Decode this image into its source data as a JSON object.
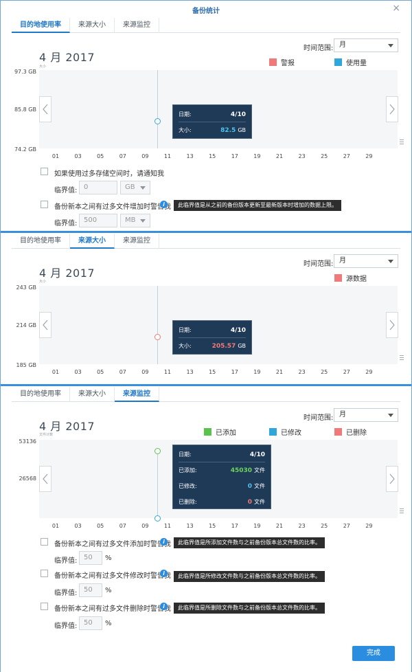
{
  "window": {
    "title": "备份统计",
    "close": "×"
  },
  "tabs": [
    "目的地使用率",
    "来源大小",
    "来源监控"
  ],
  "time_range": {
    "label": "时间范围:",
    "value": "月"
  },
  "panel1": {
    "month": "4 月 2017",
    "unit_tag": "大小",
    "legend": [
      {
        "name": "警报",
        "color": "#f07a7a"
      },
      {
        "name": "使用量",
        "color": "#2fa7db"
      }
    ],
    "yticks": [
      "97.3 GB",
      "85.8 GB",
      "74.2 GB"
    ],
    "xticks": [
      "01",
      "03",
      "05",
      "07",
      "09",
      "11",
      "13",
      "15",
      "17",
      "19",
      "21",
      "23",
      "25",
      "27",
      "29"
    ],
    "tooltip": {
      "date_label": "日期:",
      "date": "4/10",
      "size_label": "大小:",
      "size_value": "82.5",
      "size_unit": "GB"
    },
    "option1": "如果使用过多存储空间时，请通知我",
    "threshold_label": "临界值:",
    "threshold1_value": "0",
    "threshold1_unit": "GB",
    "option2": "备份新本之间有过多文件增加时警告我",
    "option2_hint": "此临界值是从之前的备份版本更新至最新版本时增加的数据上限。",
    "threshold2_value": "500",
    "threshold2_unit": "MB"
  },
  "panel2": {
    "month": "4 月 2017",
    "unit_tag": "大小",
    "legend": [
      {
        "name": "源数据",
        "color": "#f07a7a"
      }
    ],
    "yticks": [
      "243 GB",
      "214 GB",
      "185 GB"
    ],
    "xticks": [
      "01",
      "03",
      "05",
      "07",
      "09",
      "11",
      "13",
      "15",
      "17",
      "19",
      "21",
      "23",
      "25",
      "27",
      "29"
    ],
    "tooltip": {
      "date_label": "日期:",
      "date": "4/10",
      "size_label": "大小:",
      "size_value": "205.57",
      "size_unit": "GB"
    }
  },
  "panel3": {
    "month": "4 月 2017",
    "unit_tag": "文件计数",
    "legend": [
      {
        "name": "已添加",
        "color": "#5cc24e"
      },
      {
        "name": "已修改",
        "color": "#2fa7db"
      },
      {
        "name": "已删除",
        "color": "#f07a7a"
      }
    ],
    "yticks": [
      "53136",
      "26568"
    ],
    "xticks": [
      "01",
      "03",
      "05",
      "07",
      "09",
      "11",
      "13",
      "15",
      "17",
      "19",
      "21",
      "23",
      "25",
      "27",
      "29"
    ],
    "tooltip": {
      "date_label": "日期:",
      "date": "4/10",
      "added_label": "已添加:",
      "added_value": "45030",
      "modified_label": "已修改:",
      "modified_value": "0",
      "deleted_label": "已删除:",
      "deleted_value": "0",
      "unit": "文件"
    },
    "options": [
      {
        "label": "备份新本之间有过多文件添加时警告我",
        "hint": "此临界值是所添加文件数与之前备份版本总文件数的比率。",
        "value": "50",
        "unit": "%"
      },
      {
        "label": "备份新本之间有过多文件修改时警告我",
        "hint": "此临界值是所修改文件数与之前备份版本总文件数的比率。",
        "value": "50",
        "unit": "%"
      },
      {
        "label": "备份新本之间有过多文件删除时警告我",
        "hint": "此临界值是所删除文件数与之前备份版本总文件数的比率。",
        "value": "50",
        "unit": "%"
      }
    ],
    "threshold_label": "临界值:"
  },
  "footer": {
    "finish_label": "完成"
  }
}
